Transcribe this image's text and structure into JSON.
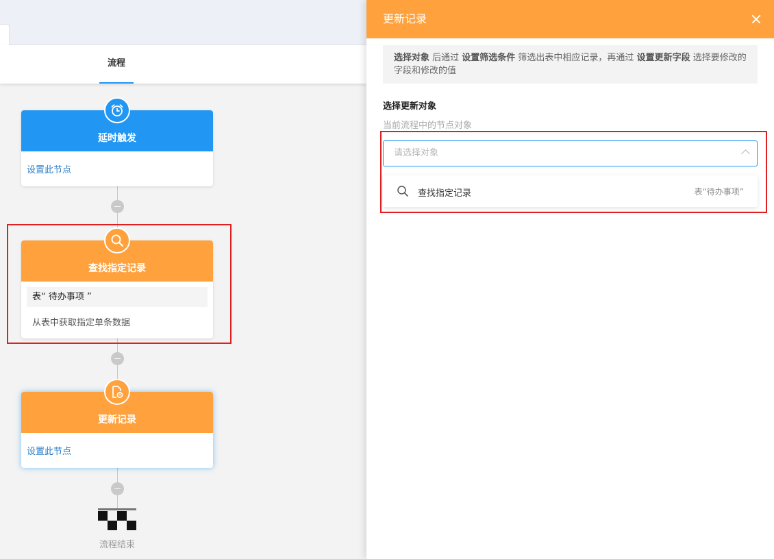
{
  "tabs": [
    {
      "label": "流程"
    }
  ],
  "flow": {
    "nodes": [
      {
        "title": "延时触发",
        "link": "设置此节点",
        "color": "#2196f3",
        "icon": "alarm-clock-icon"
      },
      {
        "title": "查找指定记录",
        "table": "表“ 待办事项 ”",
        "desc": "从表中获取指定单条数据",
        "color": "#ffa23d",
        "icon": "search-icon"
      },
      {
        "title": "更新记录",
        "link": "设置此节点",
        "color": "#ffa23d",
        "icon": "document-update-icon"
      }
    ],
    "end_label": "流程结束"
  },
  "drawer": {
    "title": "更新记录",
    "info": {
      "part1": "选择对象",
      "part2": " 后通过 ",
      "part3": "设置筛选条件",
      "part4": " 筛选出表中相应记录，再通过 ",
      "part5": "设置更新字段",
      "part6": " 选择要修改的字段和修改的值"
    },
    "section_title": "选择更新对象",
    "section_sub": "当前流程中的节点对象",
    "select_placeholder": "请选择对象",
    "options": [
      {
        "label": "查找指定记录",
        "meta": "表“待办事项”"
      }
    ]
  },
  "colors": {
    "accent_blue": "#2196f3",
    "accent_orange": "#ffa23d",
    "highlight_red": "#e02020"
  }
}
